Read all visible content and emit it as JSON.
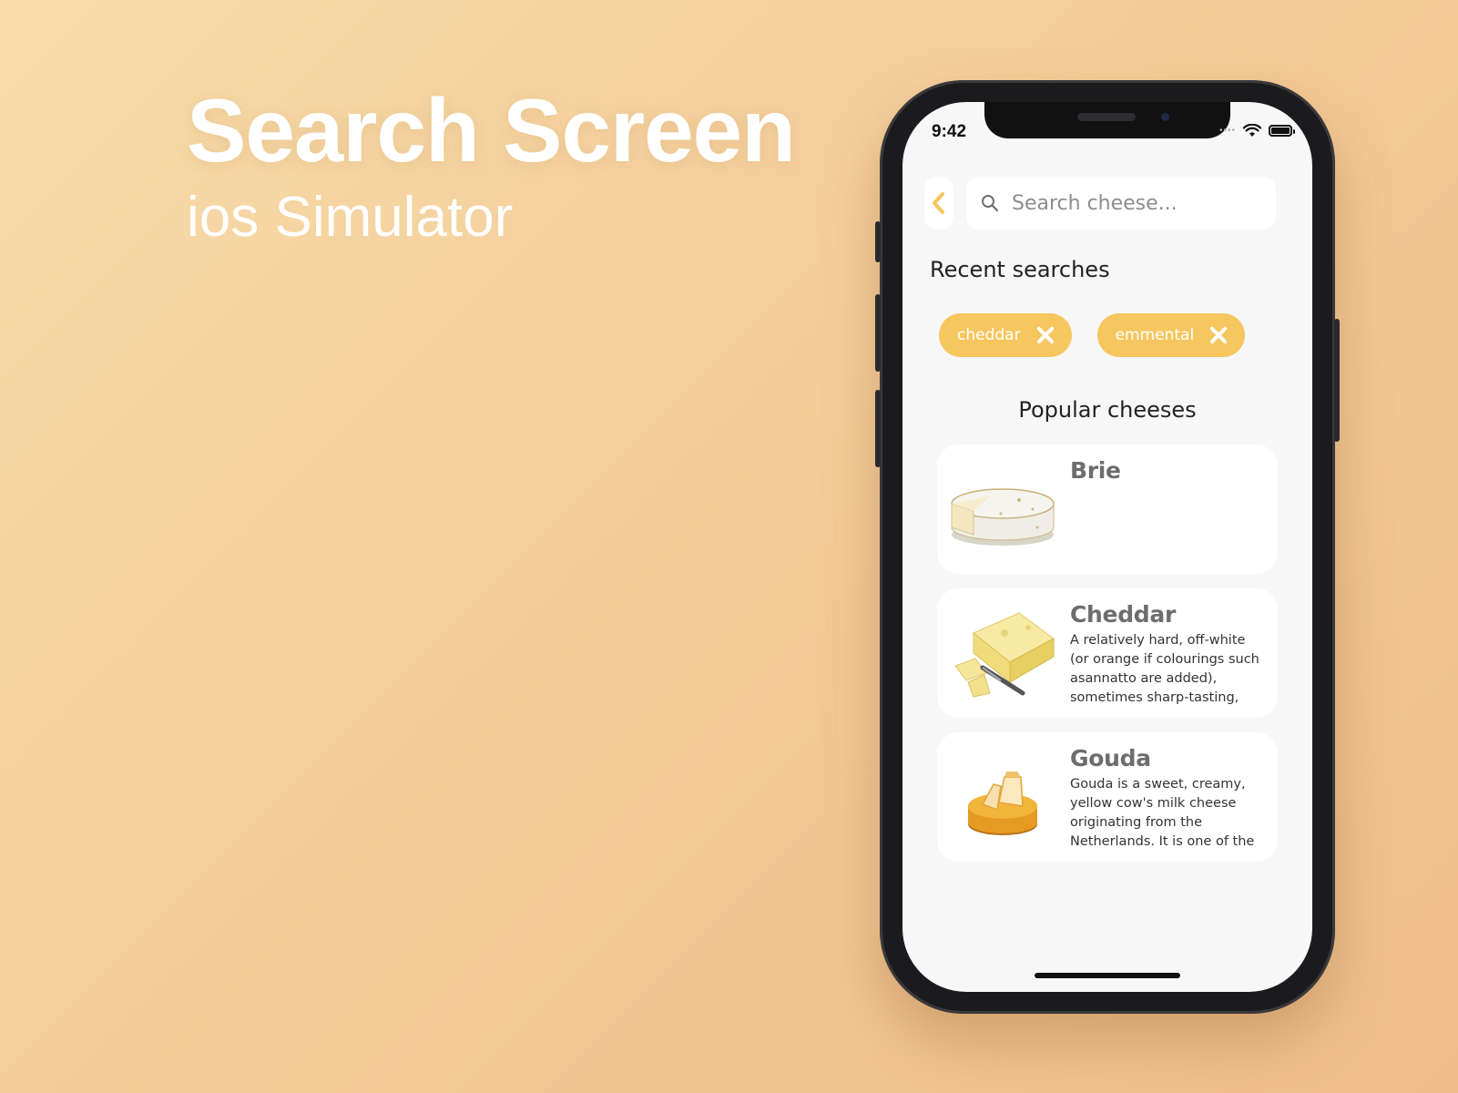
{
  "headline": {
    "title": "Search Screen",
    "subtitle": "ios Simulator"
  },
  "status_bar": {
    "time": "9:42"
  },
  "search": {
    "placeholder": "Search cheese...",
    "value": ""
  },
  "recent": {
    "title": "Recent searches",
    "chips": [
      {
        "label": "cheddar"
      },
      {
        "label": "emmental"
      }
    ]
  },
  "popular": {
    "title": "Popular cheeses",
    "items": [
      {
        "name": "Brie",
        "description": ""
      },
      {
        "name": "Cheddar",
        "description": "A relatively hard, off-white (or orange if colourings such asannatto are added), sometimes sharp-tasting,"
      },
      {
        "name": "Gouda",
        "description": "Gouda is a sweet, creamy, yellow cow's milk cheese originating from the Netherlands. It is one of the"
      }
    ]
  },
  "colors": {
    "accent": "#f6c65f",
    "background": "#f3c996",
    "screen": "#f7f7f7"
  }
}
